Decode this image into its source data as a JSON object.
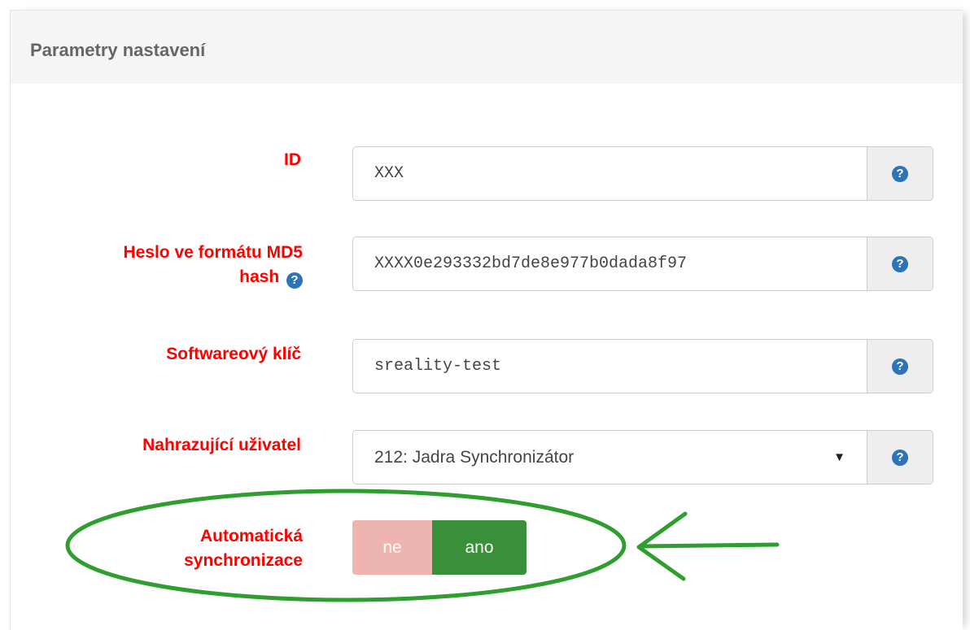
{
  "panel": {
    "title": "Parametry nastavení"
  },
  "fields": [
    {
      "label": "ID",
      "value": "XXX"
    },
    {
      "label_line1": "Heslo ve formátu MD5",
      "label_line2": "hash",
      "value": "XXXX0e293332bd7de8e977b0dada8f97"
    },
    {
      "label": "Softwareový klíč",
      "value": "sreality-test"
    },
    {
      "label": "Nahrazující uživatel",
      "value": "212: Jadra Synchronizátor"
    }
  ],
  "toggle": {
    "label_line1": "Automatická",
    "label_line2": "synchronizace",
    "off_label": "ne",
    "on_label": "ano",
    "selected": "ano"
  },
  "icons": {
    "help": "?",
    "caret": "▼"
  },
  "colors": {
    "label": "#ff0000",
    "help_icon": "#2d73b8",
    "toggle_on": "#3a8f3a",
    "toggle_off": "#eeb4b0",
    "annotation": "#2e9e2e"
  }
}
